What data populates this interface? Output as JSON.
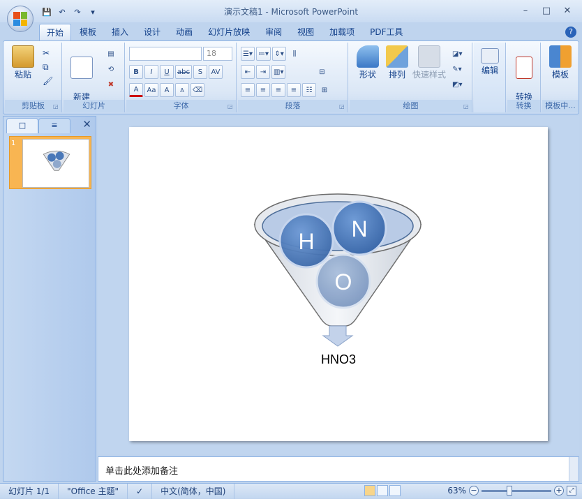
{
  "window": {
    "title": "演示文稿1 - Microsoft PowerPoint",
    "minimize": "–",
    "maximize": "□",
    "close": "✕"
  },
  "quick_access": {
    "save": "💾",
    "undo": "↶",
    "redo": "↷",
    "more": "▾"
  },
  "tabs": [
    "开始",
    "模板",
    "插入",
    "设计",
    "动画",
    "幻灯片放映",
    "审阅",
    "视图",
    "加载项",
    "PDF工具"
  ],
  "help": "?",
  "ribbon": {
    "clipboard": {
      "paste": "粘贴",
      "label": "剪贴板"
    },
    "slides": {
      "new_slide": "新建\n幻灯片",
      "label": "幻灯片"
    },
    "font": {
      "font_name": "",
      "font_size": "18",
      "label": "字体",
      "bold": "B",
      "italic": "I",
      "underline": "U",
      "strike": "abc",
      "shadow": "S",
      "spacing": "AV",
      "color": "A",
      "case": "Aa",
      "grow": "A",
      "shrink": "A"
    },
    "paragraph": {
      "label": "段落"
    },
    "drawing": {
      "shape": "形状",
      "arrange": "排列",
      "quick_styles": "快速样式",
      "label": "绘图"
    },
    "editing": {
      "edit": "编辑"
    },
    "convert": {
      "to_pdf": "转换\nPDF",
      "label": "转换"
    },
    "template": {
      "template": "模板",
      "label": "模板中..."
    }
  },
  "slide_pane": {
    "tab_slides": "□",
    "tab_outline": "≡",
    "close": "✕",
    "thumb_number": "1"
  },
  "slide": {
    "circles": [
      {
        "letter": "H"
      },
      {
        "letter": "N"
      },
      {
        "letter": "O"
      }
    ],
    "result": "HNO3"
  },
  "notes_placeholder": "单击此处添加备注",
  "status": {
    "slide_count": "幻灯片 1/1",
    "theme": "\"Office 主题\"",
    "language": "中文(简体，中国)",
    "zoom": "63%"
  },
  "colors": {
    "circle_dark": "#4a78b8",
    "circle_light": "#8fa8cc",
    "accent": "#15428b",
    "thumb_highlight": "#f8b552"
  }
}
